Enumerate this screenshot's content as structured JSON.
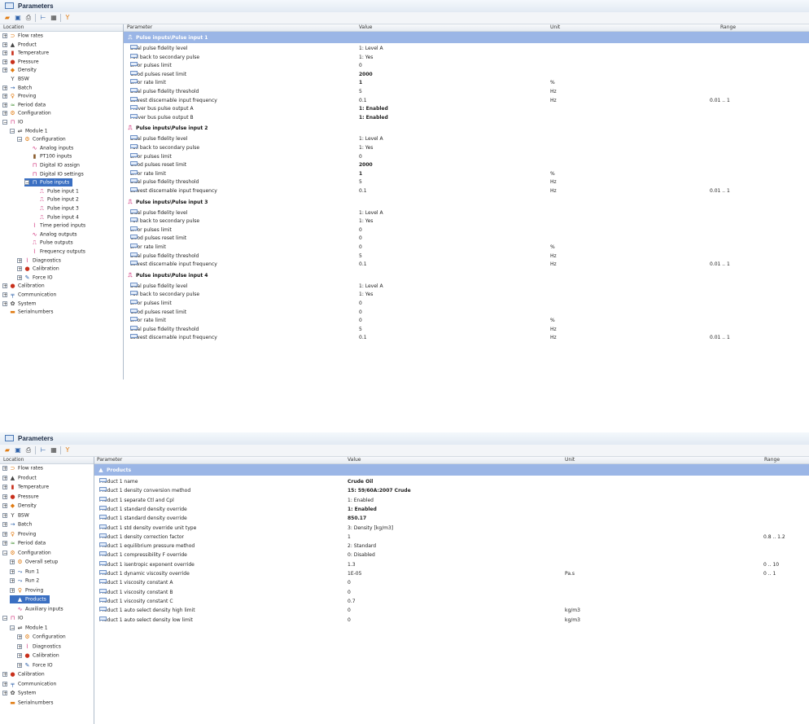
{
  "window_title": "Parameters",
  "tree_header": "Location",
  "columns": {
    "parameter": "Parameter",
    "value": "Value",
    "unit": "Unit",
    "range": "Range"
  },
  "toolbar_icons": [
    "open-icon",
    "save-icon",
    "print-icon",
    "tree-icon",
    "grid-icon",
    "filter-icon"
  ],
  "colors": {
    "selection": "#3a6fc2",
    "group_highlight": "#9bb6e6",
    "pulse_icon": "#d0307a"
  },
  "top": {
    "tree": [
      {
        "label": "Flow rates",
        "level": 0,
        "exp": "+",
        "icon": "flow-rates-icon",
        "glyph": "⊃",
        "cls": "c-orange"
      },
      {
        "label": "Product",
        "level": 0,
        "exp": "+",
        "icon": "product-icon",
        "glyph": "▲",
        "cls": "c-dark"
      },
      {
        "label": "Temperature",
        "level": 0,
        "exp": "+",
        "icon": "temperature-icon",
        "glyph": "▮",
        "cls": "c-red"
      },
      {
        "label": "Pressure",
        "level": 0,
        "exp": "+",
        "icon": "pressure-icon",
        "glyph": "●",
        "cls": "c-red"
      },
      {
        "label": "Density",
        "level": 0,
        "exp": "+",
        "icon": "density-icon",
        "glyph": "◆",
        "cls": "c-orange"
      },
      {
        "label": "BSW",
        "level": 0,
        "exp": "",
        "icon": "bsw-icon",
        "glyph": "Y",
        "cls": "c-dark"
      },
      {
        "label": "Batch",
        "level": 0,
        "exp": "+",
        "icon": "batch-icon",
        "glyph": "→",
        "cls": "c-blue"
      },
      {
        "label": "Proving",
        "level": 0,
        "exp": "+",
        "icon": "proving-icon",
        "glyph": "♀",
        "cls": "c-orange"
      },
      {
        "label": "Period data",
        "level": 0,
        "exp": "+",
        "icon": "period-data-icon",
        "glyph": "≈",
        "cls": "c-green"
      },
      {
        "label": "Configuration",
        "level": 0,
        "exp": "+",
        "icon": "configuration-icon",
        "glyph": "⚙",
        "cls": "c-orange"
      },
      {
        "label": "IO",
        "level": 0,
        "exp": "−",
        "icon": "io-icon",
        "glyph": "⊓",
        "cls": "c-pink"
      },
      {
        "label": "Module 1",
        "level": 1,
        "exp": "−",
        "icon": "module-icon",
        "glyph": "⇌",
        "cls": "c-dark"
      },
      {
        "label": "Configuration",
        "level": 2,
        "exp": "−",
        "icon": "configuration-icon",
        "glyph": "⚙",
        "cls": "c-orange"
      },
      {
        "label": "Analog inputs",
        "level": 3,
        "exp": "",
        "icon": "analog-inputs-icon",
        "glyph": "∿",
        "cls": "c-pink"
      },
      {
        "label": "PT100 inputs",
        "level": 3,
        "exp": "",
        "icon": "pt100-icon",
        "glyph": "▮",
        "cls": "c-brown"
      },
      {
        "label": "Digital IO assign",
        "level": 3,
        "exp": "",
        "icon": "digital-io-icon",
        "glyph": "⊓",
        "cls": "c-pink"
      },
      {
        "label": "Digital IO settings",
        "level": 3,
        "exp": "",
        "icon": "digital-io-icon",
        "glyph": "⊓",
        "cls": "c-pink"
      },
      {
        "label": "Pulse inputs",
        "level": 3,
        "exp": "−",
        "icon": "pulse-inputs-icon",
        "glyph": "⊓",
        "cls": "",
        "selected": true
      },
      {
        "label": "Pulse input 1",
        "level": 4,
        "exp": "",
        "icon": "pulse-icon",
        "glyph": "⎍",
        "cls": "c-pink"
      },
      {
        "label": "Pulse input 2",
        "level": 4,
        "exp": "",
        "icon": "pulse-icon",
        "glyph": "⎍",
        "cls": "c-pink"
      },
      {
        "label": "Pulse input 3",
        "level": 4,
        "exp": "",
        "icon": "pulse-icon",
        "glyph": "⎍",
        "cls": "c-pink"
      },
      {
        "label": "Pulse input 4",
        "level": 4,
        "exp": "",
        "icon": "pulse-icon",
        "glyph": "⎍",
        "cls": "c-pink"
      },
      {
        "label": "Time period inputs",
        "level": 3,
        "exp": "",
        "icon": "time-period-icon",
        "glyph": "⌇",
        "cls": "c-pink"
      },
      {
        "label": "Analog outputs",
        "level": 3,
        "exp": "",
        "icon": "analog-outputs-icon",
        "glyph": "∿",
        "cls": "c-pink"
      },
      {
        "label": "Pulse outputs",
        "level": 3,
        "exp": "",
        "icon": "pulse-outputs-icon",
        "glyph": "⎍",
        "cls": "c-pink"
      },
      {
        "label": "Frequency outputs",
        "level": 3,
        "exp": "",
        "icon": "frequency-outputs-icon",
        "glyph": "⌇",
        "cls": "c-pink"
      },
      {
        "label": "Diagnostics",
        "level": 2,
        "exp": "+",
        "icon": "diagnostics-icon",
        "glyph": "⌇",
        "cls": "c-pink"
      },
      {
        "label": "Calibration",
        "level": 2,
        "exp": "+",
        "icon": "calibration-icon",
        "glyph": "●",
        "cls": "c-red"
      },
      {
        "label": "Force IO",
        "level": 2,
        "exp": "+",
        "icon": "force-io-icon",
        "glyph": "✎",
        "cls": "c-blue"
      },
      {
        "label": "Calibration",
        "level": 0,
        "exp": "+",
        "icon": "calibration-icon",
        "glyph": "●",
        "cls": "c-red"
      },
      {
        "label": "Communication",
        "level": 0,
        "exp": "+",
        "icon": "communication-icon",
        "glyph": "╤",
        "cls": "c-blue"
      },
      {
        "label": "System",
        "level": 0,
        "exp": "+",
        "icon": "system-icon",
        "glyph": "✿",
        "cls": "c-dark"
      },
      {
        "label": "Serialnumbers",
        "level": 0,
        "exp": "",
        "icon": "serialnumbers-icon",
        "glyph": "▬",
        "cls": "c-orange"
      }
    ],
    "groups": [
      {
        "title": "Pulse inputs\\Pulse input 1",
        "selected": true,
        "rows": [
          {
            "p": "Dual pulse fidelity level",
            "v": "1: Level A",
            "u": "",
            "r": "",
            "b": false
          },
          {
            "p": "Fall back to secondary pulse",
            "v": "1: Yes",
            "u": "",
            "r": "",
            "b": false
          },
          {
            "p": "Error pulses limit",
            "v": "0",
            "u": "",
            "r": "",
            "b": false
          },
          {
            "p": "Good pulses reset limit",
            "v": "2000",
            "u": "",
            "r": "",
            "b": true
          },
          {
            "p": "Error rate limit",
            "v": "1",
            "u": "%",
            "r": "",
            "b": true
          },
          {
            "p": "Dual pulse fidelity threshold",
            "v": "5",
            "u": "Hz",
            "r": "",
            "b": false
          },
          {
            "p": "Lowest discernable input frequency",
            "v": "0.1",
            "u": "Hz",
            "r": "0.01 .. 1",
            "b": false
          },
          {
            "p": "Prover bus pulse output A",
            "v": "1: Enabled",
            "u": "",
            "r": "",
            "b": true
          },
          {
            "p": "Prover bus pulse output B",
            "v": "1: Enabled",
            "u": "",
            "r": "",
            "b": true
          }
        ]
      },
      {
        "title": "Pulse inputs\\Pulse input 2",
        "selected": false,
        "rows": [
          {
            "p": "Dual pulse fidelity level",
            "v": "1: Level A",
            "u": "",
            "r": "",
            "b": false
          },
          {
            "p": "Fall back to secondary pulse",
            "v": "1: Yes",
            "u": "",
            "r": "",
            "b": false
          },
          {
            "p": "Error pulses limit",
            "v": "0",
            "u": "",
            "r": "",
            "b": false
          },
          {
            "p": "Good pulses reset limit",
            "v": "2000",
            "u": "",
            "r": "",
            "b": true
          },
          {
            "p": "Error rate limit",
            "v": "1",
            "u": "%",
            "r": "",
            "b": true
          },
          {
            "p": "Dual pulse fidelity threshold",
            "v": "5",
            "u": "Hz",
            "r": "",
            "b": false
          },
          {
            "p": "Lowest discernable input frequency",
            "v": "0.1",
            "u": "Hz",
            "r": "0.01 .. 1",
            "b": false
          }
        ]
      },
      {
        "title": "Pulse inputs\\Pulse input 3",
        "selected": false,
        "rows": [
          {
            "p": "Dual pulse fidelity level",
            "v": "1: Level A",
            "u": "",
            "r": "",
            "b": false
          },
          {
            "p": "Fall back to secondary pulse",
            "v": "1: Yes",
            "u": "",
            "r": "",
            "b": false
          },
          {
            "p": "Error pulses limit",
            "v": "0",
            "u": "",
            "r": "",
            "b": false
          },
          {
            "p": "Good pulses reset limit",
            "v": "0",
            "u": "",
            "r": "",
            "b": false
          },
          {
            "p": "Error rate limit",
            "v": "0",
            "u": "%",
            "r": "",
            "b": false
          },
          {
            "p": "Dual pulse fidelity threshold",
            "v": "5",
            "u": "Hz",
            "r": "",
            "b": false
          },
          {
            "p": "Lowest discernable input frequency",
            "v": "0.1",
            "u": "Hz",
            "r": "0.01 .. 1",
            "b": false
          }
        ]
      },
      {
        "title": "Pulse inputs\\Pulse input 4",
        "selected": false,
        "rows": [
          {
            "p": "Dual pulse fidelity level",
            "v": "1: Level A",
            "u": "",
            "r": "",
            "b": false
          },
          {
            "p": "Fall back to secondary pulse",
            "v": "1: Yes",
            "u": "",
            "r": "",
            "b": false
          },
          {
            "p": "Error pulses limit",
            "v": "0",
            "u": "",
            "r": "",
            "b": false
          },
          {
            "p": "Good pulses reset limit",
            "v": "0",
            "u": "",
            "r": "",
            "b": false
          },
          {
            "p": "Error rate limit",
            "v": "0",
            "u": "%",
            "r": "",
            "b": false
          },
          {
            "p": "Dual pulse fidelity threshold",
            "v": "5",
            "u": "Hz",
            "r": "",
            "b": false
          },
          {
            "p": "Lowest discernable input frequency",
            "v": "0.1",
            "u": "Hz",
            "r": "0.01 .. 1",
            "b": false
          }
        ]
      }
    ]
  },
  "bottom": {
    "tree": [
      {
        "label": "Flow rates",
        "level": 0,
        "exp": "+",
        "icon": "flow-rates-icon",
        "glyph": "⊃",
        "cls": "c-orange"
      },
      {
        "label": "Product",
        "level": 0,
        "exp": "+",
        "icon": "product-icon",
        "glyph": "▲",
        "cls": "c-dark"
      },
      {
        "label": "Temperature",
        "level": 0,
        "exp": "+",
        "icon": "temperature-icon",
        "glyph": "▮",
        "cls": "c-red"
      },
      {
        "label": "Pressure",
        "level": 0,
        "exp": "+",
        "icon": "pressure-icon",
        "glyph": "●",
        "cls": "c-red"
      },
      {
        "label": "Density",
        "level": 0,
        "exp": "+",
        "icon": "density-icon",
        "glyph": "◆",
        "cls": "c-orange"
      },
      {
        "label": "BSW",
        "level": 0,
        "exp": "+",
        "icon": "bsw-icon",
        "glyph": "Y",
        "cls": "c-dark"
      },
      {
        "label": "Batch",
        "level": 0,
        "exp": "+",
        "icon": "batch-icon",
        "glyph": "→",
        "cls": "c-blue"
      },
      {
        "label": "Proving",
        "level": 0,
        "exp": "+",
        "icon": "proving-icon",
        "glyph": "♀",
        "cls": "c-orange"
      },
      {
        "label": "Period data",
        "level": 0,
        "exp": "+",
        "icon": "period-data-icon",
        "glyph": "≈",
        "cls": "c-green"
      },
      {
        "label": "Configuration",
        "level": 0,
        "exp": "−",
        "icon": "configuration-icon",
        "glyph": "⚙",
        "cls": "c-orange"
      },
      {
        "label": "Overall setup",
        "level": 1,
        "exp": "+",
        "icon": "overall-setup-icon",
        "glyph": "⚙",
        "cls": "c-orange"
      },
      {
        "label": "Run 1",
        "level": 1,
        "exp": "+",
        "icon": "run-icon",
        "glyph": "⤳",
        "cls": "c-blue"
      },
      {
        "label": "Run 2",
        "level": 1,
        "exp": "+",
        "icon": "run-icon",
        "glyph": "⤳",
        "cls": "c-blue"
      },
      {
        "label": "Proving",
        "level": 1,
        "exp": "+",
        "icon": "proving-icon",
        "glyph": "♀",
        "cls": "c-orange"
      },
      {
        "label": "Products",
        "level": 1,
        "exp": "",
        "icon": "products-icon",
        "glyph": "▲",
        "cls": "",
        "selected": true
      },
      {
        "label": "Auxiliary inputs",
        "level": 1,
        "exp": "",
        "icon": "auxiliary-inputs-icon",
        "glyph": "∿",
        "cls": "c-pink"
      },
      {
        "label": "IO",
        "level": 0,
        "exp": "−",
        "icon": "io-icon",
        "glyph": "⊓",
        "cls": "c-pink"
      },
      {
        "label": "Module 1",
        "level": 1,
        "exp": "−",
        "icon": "module-icon",
        "glyph": "⇌",
        "cls": "c-dark"
      },
      {
        "label": "Configuration",
        "level": 2,
        "exp": "+",
        "icon": "configuration-icon",
        "glyph": "⚙",
        "cls": "c-orange"
      },
      {
        "label": "Diagnostics",
        "level": 2,
        "exp": "+",
        "icon": "diagnostics-icon",
        "glyph": "⌇",
        "cls": "c-pink"
      },
      {
        "label": "Calibration",
        "level": 2,
        "exp": "+",
        "icon": "calibration-icon",
        "glyph": "●",
        "cls": "c-red"
      },
      {
        "label": "Force IO",
        "level": 2,
        "exp": "+",
        "icon": "force-io-icon",
        "glyph": "✎",
        "cls": "c-blue"
      },
      {
        "label": "Calibration",
        "level": 0,
        "exp": "+",
        "icon": "calibration-icon",
        "glyph": "●",
        "cls": "c-red"
      },
      {
        "label": "Communication",
        "level": 0,
        "exp": "+",
        "icon": "communication-icon",
        "glyph": "╤",
        "cls": "c-blue"
      },
      {
        "label": "System",
        "level": 0,
        "exp": "+",
        "icon": "system-icon",
        "glyph": "✿",
        "cls": "c-dark"
      },
      {
        "label": "Serialnumbers",
        "level": 0,
        "exp": "",
        "icon": "serialnumbers-icon",
        "glyph": "▬",
        "cls": "c-orange"
      }
    ],
    "groups": [
      {
        "title": "Products",
        "selected": true,
        "rows": [
          {
            "p": "Product 1 name",
            "v": "Crude Oil",
            "u": "",
            "r": "",
            "b": true
          },
          {
            "p": "Product 1 density conversion method",
            "v": "15: 59/60A:2007 Crude",
            "u": "",
            "r": "",
            "b": true
          },
          {
            "p": "Product 1 separate Ctl and Cpl",
            "v": "1: Enabled",
            "u": "",
            "r": "",
            "b": false
          },
          {
            "p": "Product 1 standard density override",
            "v": "1: Enabled",
            "u": "",
            "r": "",
            "b": true
          },
          {
            "p": "Product 1 standard density override",
            "v": "850.17",
            "u": "",
            "r": "",
            "b": true
          },
          {
            "p": "Product 1 std density override unit type",
            "v": "3: Density [kg/m3]",
            "u": "",
            "r": "",
            "b": false
          },
          {
            "p": "Product 1 density correction factor",
            "v": "1",
            "u": "",
            "r": "0.8 .. 1.2",
            "b": false
          },
          {
            "p": "Product 1 equilibrium pressure method",
            "v": "2: Standard",
            "u": "",
            "r": "",
            "b": false
          },
          {
            "p": "Product 1 compressibility F override",
            "v": "0: Disabled",
            "u": "",
            "r": "",
            "b": false
          },
          {
            "p": "Product 1 isentropic exponent override",
            "v": "1.3",
            "u": "",
            "r": "0 .. 10",
            "b": false
          },
          {
            "p": "Product 1 dynamic viscosity override",
            "v": "1E-05",
            "u": "Pa.s",
            "r": "0 .. 1",
            "b": false
          },
          {
            "p": "Product 1 viscosity constant A",
            "v": "0",
            "u": "",
            "r": "",
            "b": false
          },
          {
            "p": "Product 1 viscosity constant B",
            "v": "0",
            "u": "",
            "r": "",
            "b": false
          },
          {
            "p": "Product 1 viscosity constant C",
            "v": "0.7",
            "u": "",
            "r": "",
            "b": false
          },
          {
            "p": "Product 1 auto select density high limit",
            "v": "0",
            "u": "kg/m3",
            "r": "",
            "b": false
          },
          {
            "p": "Product 1 auto select density low limit",
            "v": "0",
            "u": "kg/m3",
            "r": "",
            "b": false
          }
        ]
      }
    ]
  }
}
